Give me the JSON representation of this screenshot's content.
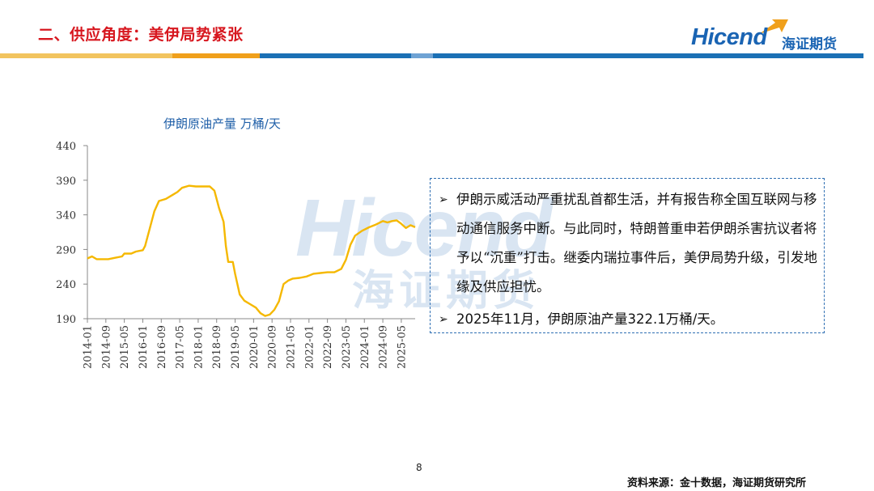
{
  "header": {
    "title": "二、供应角度：美伊局势紧张",
    "logo_text": "Hicend",
    "logo_cn": "海证期货",
    "bar_colors": [
      "#f2c45f",
      "#f0a01b",
      "#1b70b5",
      "#6fa3d4",
      "#1b70b5"
    ]
  },
  "watermark": {
    "text": "Hicend",
    "cn": "海证期货"
  },
  "chart_data": {
    "type": "line",
    "title": "伊朗原油产量 万桶/天",
    "ylim": [
      190,
      440
    ],
    "yticks": [
      190,
      240,
      290,
      340,
      390,
      440
    ],
    "x_tick_labels": [
      "2014-01",
      "2014-09",
      "2015-05",
      "2016-01",
      "2016-09",
      "2017-05",
      "2018-01",
      "2018-09",
      "2019-05",
      "2020-01",
      "2020-09",
      "2021-05",
      "2022-01",
      "2022-09",
      "2023-05",
      "2024-01",
      "2024-09",
      "2025-05"
    ],
    "start": "2014-01",
    "end": "2025-11",
    "series": [
      {
        "color": "#f5b800",
        "anchors": [
          [
            "2014-01",
            277
          ],
          [
            "2014-03",
            280
          ],
          [
            "2014-05",
            276
          ],
          [
            "2014-08",
            276
          ],
          [
            "2014-10",
            276
          ],
          [
            "2015-01",
            278
          ],
          [
            "2015-04",
            280
          ],
          [
            "2015-05",
            284
          ],
          [
            "2015-08",
            284
          ],
          [
            "2015-10",
            287
          ],
          [
            "2016-01",
            289
          ],
          [
            "2016-02",
            295
          ],
          [
            "2016-04",
            320
          ],
          [
            "2016-06",
            345
          ],
          [
            "2016-08",
            360
          ],
          [
            "2016-11",
            363
          ],
          [
            "2017-02",
            369
          ],
          [
            "2017-04",
            373
          ],
          [
            "2017-06",
            379
          ],
          [
            "2017-09",
            382
          ],
          [
            "2017-12",
            381
          ],
          [
            "2018-03",
            381
          ],
          [
            "2018-06",
            381
          ],
          [
            "2018-08",
            375
          ],
          [
            "2018-10",
            350
          ],
          [
            "2018-12",
            330
          ],
          [
            "2019-01",
            295
          ],
          [
            "2019-02",
            272
          ],
          [
            "2019-04",
            272
          ],
          [
            "2019-05",
            255
          ],
          [
            "2019-07",
            225
          ],
          [
            "2019-09",
            216
          ],
          [
            "2019-12",
            210
          ],
          [
            "2020-02",
            206
          ],
          [
            "2020-04",
            198
          ],
          [
            "2020-06",
            194
          ],
          [
            "2020-08",
            196
          ],
          [
            "2020-10",
            203
          ],
          [
            "2020-12",
            215
          ],
          [
            "2021-02",
            240
          ],
          [
            "2021-04",
            245
          ],
          [
            "2021-06",
            248
          ],
          [
            "2021-09",
            249
          ],
          [
            "2021-12",
            251
          ],
          [
            "2022-03",
            255
          ],
          [
            "2022-06",
            256
          ],
          [
            "2022-09",
            257
          ],
          [
            "2022-12",
            257
          ],
          [
            "2023-03",
            262
          ],
          [
            "2023-05",
            275
          ],
          [
            "2023-07",
            297
          ],
          [
            "2023-09",
            310
          ],
          [
            "2023-12",
            317
          ],
          [
            "2024-03",
            322
          ],
          [
            "2024-06",
            326
          ],
          [
            "2024-09",
            331
          ],
          [
            "2024-11",
            329
          ],
          [
            "2025-01",
            331
          ],
          [
            "2025-03",
            332
          ],
          [
            "2025-05",
            327
          ],
          [
            "2025-07",
            321
          ],
          [
            "2025-09",
            325
          ],
          [
            "2025-11",
            322.1
          ]
        ]
      }
    ]
  },
  "infobox": {
    "bullets": [
      "伊朗示威活动严重扰乱首都生活，并有报告称全国互联网与移动通信服务中断。与此同时，特朗普重申若伊朗杀害抗议者将予以“沉重”打击。继委内瑞拉事件后，美伊局势升级，引发地缘及供应担忧。",
      "2025年11月，伊朗原油产量322.1万桶/天。"
    ],
    "bullet_mark": "➢"
  },
  "footer": {
    "page_number": "8",
    "source": "资料来源：金十数据，海证期货研究所"
  }
}
